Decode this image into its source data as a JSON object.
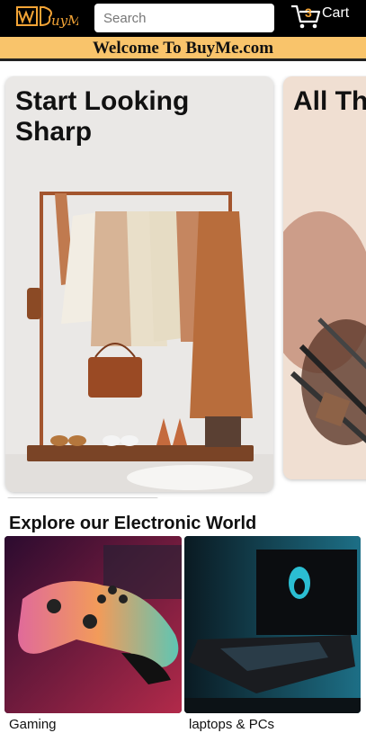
{
  "header": {
    "logo_text": "BuyMe",
    "search": {
      "placeholder": "Search",
      "value": ""
    },
    "cart": {
      "count": "3",
      "label": "Cart"
    }
  },
  "banner": {
    "text": "Welcome To BuyMe.com"
  },
  "carousel": {
    "cards": [
      {
        "title": "Start Looking Sharp"
      },
      {
        "title": "All Th"
      }
    ]
  },
  "explore": {
    "title": "Explore our Electronic World",
    "tiles": [
      {
        "label": "Gaming"
      },
      {
        "label": "laptops & PCs"
      }
    ]
  },
  "colors": {
    "header_bg": "#000000",
    "banner_bg": "#f9c46b",
    "accent": "#f3a436"
  }
}
